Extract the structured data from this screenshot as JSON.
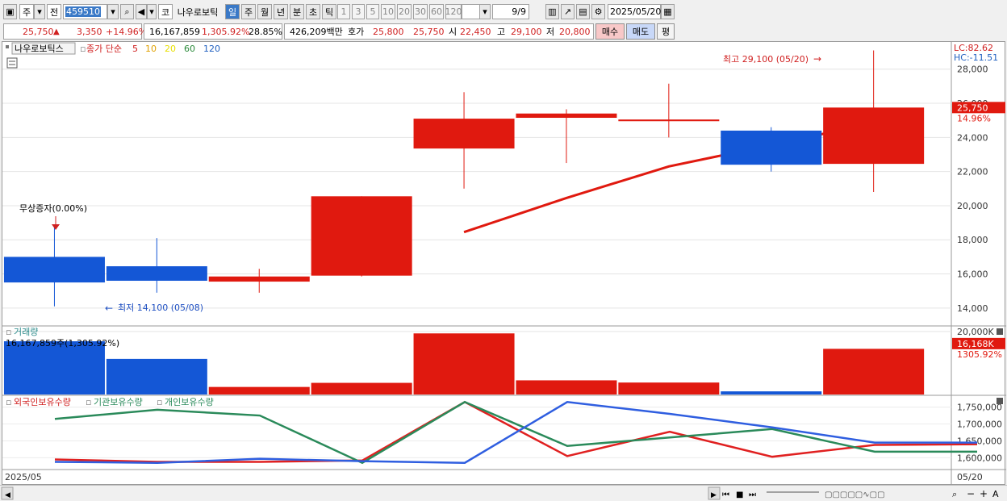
{
  "toolbar": {
    "mode": "주",
    "prev_label": "전",
    "code": "459510",
    "market": "코",
    "stock_name": "나우로보틱",
    "periods": [
      "일",
      "주",
      "월",
      "년",
      "분",
      "초",
      "틱"
    ],
    "selected_period": "일",
    "intervals": [
      "1",
      "3",
      "5",
      "10",
      "20",
      "30",
      "60",
      "120"
    ],
    "page": "9/9",
    "date": "2025/05/20"
  },
  "quote": {
    "price": "25,750",
    "change": "3,350",
    "rate": "+14.96%",
    "volume": "16,167,859",
    "volume_rate": "1,305.92%",
    "turnover": "28.85%",
    "amount": "426,209백만",
    "hoga_label": "호가",
    "ask": "25,800",
    "bid": "25,750",
    "open_label": "시",
    "open": "22,450",
    "high_label": "고",
    "high": "29,100",
    "low_label": "저",
    "low": "20,800",
    "buy_label": "매수",
    "sell_label": "매도",
    "eval_label": "평"
  },
  "price_panel": {
    "stock_label": "나우로보틱스",
    "ma_label": "종가 단순",
    "ma_periods": [
      {
        "p": "5",
        "color": "#d02020"
      },
      {
        "p": "10",
        "color": "#e0a000"
      },
      {
        "p": "20",
        "color": "#e8e000"
      },
      {
        "p": "60",
        "color": "#2a8a3a"
      },
      {
        "p": "120",
        "color": "#2060c0"
      }
    ],
    "lc_label": "LC:82.62",
    "hc_label": "HC:-11.51",
    "current_price_label": "25,750",
    "current_rate_label": "14.96%",
    "high_annotation": "최고 29,100 (05/20)",
    "low_annotation": "최저 14,100 (05/08)",
    "event_annotation": "무상증자(0.00%)",
    "y_ticks": [
      "28,000",
      "26,000",
      "24,000",
      "22,000",
      "20,000",
      "18,000",
      "16,000",
      "14,000"
    ]
  },
  "volume_panel": {
    "title": "거래량",
    "current_label": "16,167,859주(1,305.92%)",
    "y_tick": "20,000K",
    "right_value": "16,168K",
    "right_rate": "1305.92%"
  },
  "holdings_panel": {
    "legend": [
      {
        "name": "외국인보유수량",
        "color": "#d02020"
      },
      {
        "name": "기관보유수량",
        "color": "#2a8a5a"
      },
      {
        "name": "개인보유수량",
        "color": "#2a8a5a"
      }
    ],
    "y_ticks": [
      "1,750,000",
      "1,700,000",
      "1,650,000",
      "1,600,000"
    ]
  },
  "x_axis": {
    "start_label": "2025/05",
    "end_label": "05/20"
  },
  "chart_data": [
    {
      "type": "candlestick",
      "title": "나우로보틱스",
      "ylim": [
        13000,
        29500
      ],
      "candles": [
        {
          "o": 15500,
          "h": 18800,
          "l": 14100,
          "c": 17000,
          "dir": "down"
        },
        {
          "o": 16450,
          "h": 18100,
          "l": 14900,
          "c": 15600,
          "dir": "down"
        },
        {
          "o": 15550,
          "h": 16300,
          "l": 14900,
          "c": 15850,
          "dir": "up"
        },
        {
          "o": 15900,
          "h": 20550,
          "l": 15850,
          "c": 20550,
          "dir": "up"
        },
        {
          "o": 23350,
          "h": 26650,
          "l": 21000,
          "c": 25100,
          "dir": "up"
        },
        {
          "o": 25150,
          "h": 25650,
          "l": 22500,
          "c": 25400,
          "dir": "up"
        },
        {
          "o": 24950,
          "h": 27150,
          "l": 24000,
          "c": 25050,
          "dir": "up"
        },
        {
          "o": 24400,
          "h": 24600,
          "l": 22000,
          "c": 22400,
          "dir": "down"
        },
        {
          "o": 22450,
          "h": 29100,
          "l": 20800,
          "c": 25750,
          "dir": "up"
        }
      ],
      "ma5": [
        null,
        null,
        null,
        null,
        18450,
        20450,
        22300,
        23550,
        24850
      ]
    },
    {
      "type": "bar",
      "title": "거래량",
      "values": [
        16900,
        11300,
        2400,
        3700,
        19400,
        4500,
        3800,
        1000,
        14500
      ],
      "colors": [
        "down",
        "down",
        "up",
        "up",
        "up",
        "up",
        "up",
        "down",
        "up"
      ],
      "ylim": [
        0,
        21000
      ]
    },
    {
      "type": "line",
      "ylim": [
        1570000,
        1780000
      ],
      "series": [
        {
          "name": "외국인보유수량",
          "color": "#e02020",
          "values": [
            1595000,
            1588000,
            1588000,
            1592000,
            1765000,
            1605000,
            1677000,
            1603000,
            1638000,
            1640000
          ]
        },
        {
          "name": "기관보유수량",
          "color": "#2a8a5a",
          "values": [
            1715000,
            1742000,
            1725000,
            1585000,
            1765000,
            1635000,
            1660000,
            1685000,
            1618000,
            1618000
          ]
        },
        {
          "name": "개인보유수량",
          "color": "#2f5ee0",
          "values": [
            1588000,
            1585000,
            1597000,
            1590000,
            1585000,
            1765000,
            1730000,
            1690000,
            1645000,
            1645000
          ]
        }
      ]
    }
  ]
}
